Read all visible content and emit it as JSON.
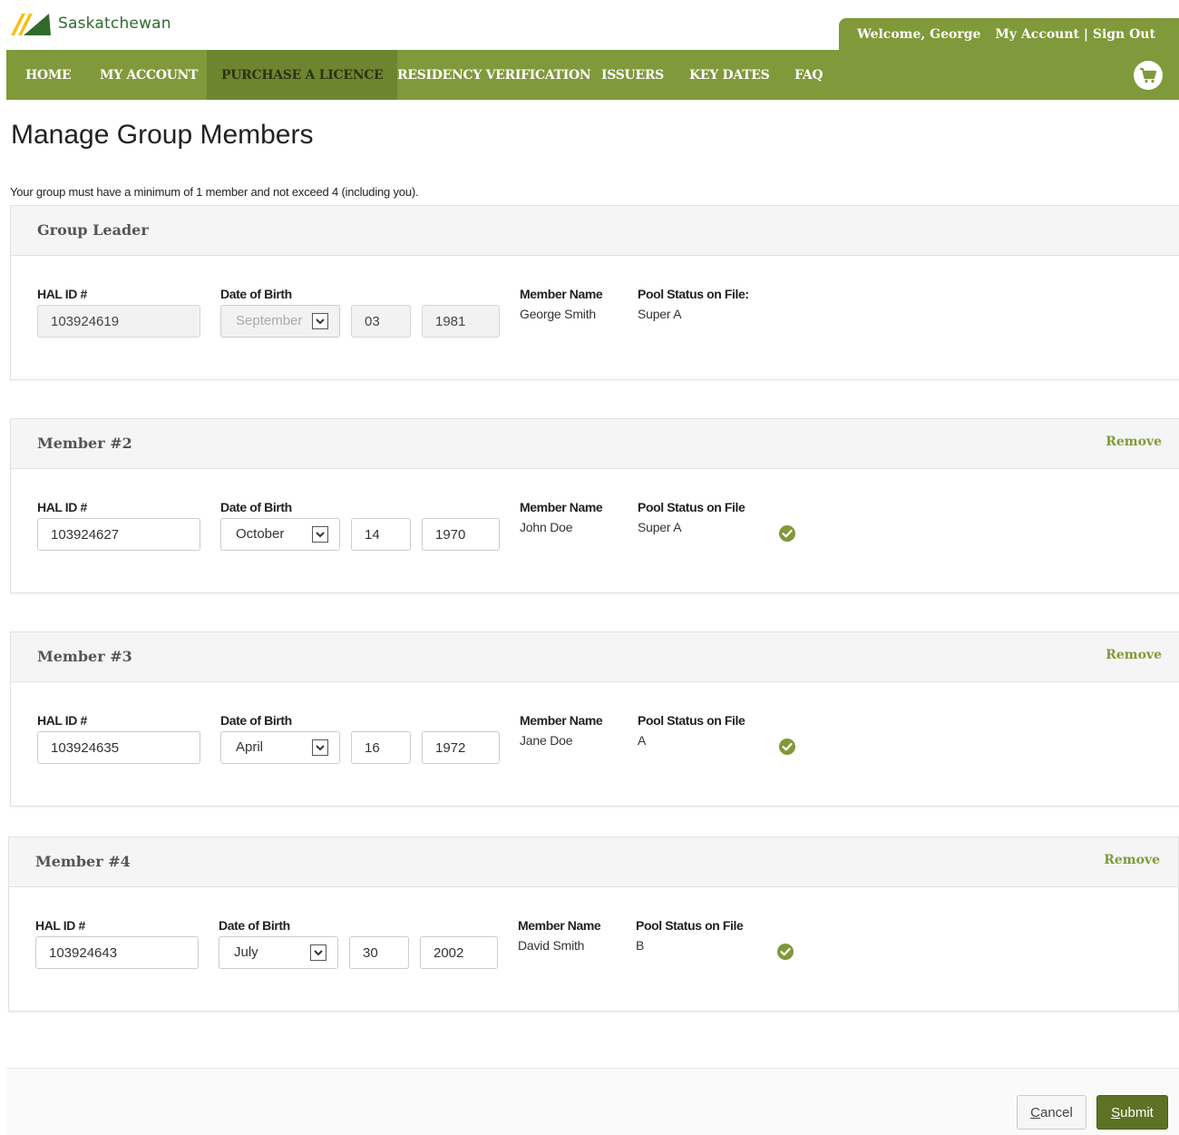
{
  "header": {
    "brand": "Saskatchewan",
    "welcome": "Welcome, George",
    "account_links": "My Account | Sign Out"
  },
  "nav": {
    "items": [
      "HOME",
      "MY ACCOUNT",
      "PURCHASE A LICENCE",
      "RESIDENCY VERIFICATION",
      "ISSUERS",
      "KEY DATES",
      "FAQ"
    ],
    "active": "PURCHASE A LICENCE"
  },
  "page": {
    "title": "Manage Group Members",
    "intro": "Your group must have a minimum of 1 member and not exceed 4 (including you)."
  },
  "labels": {
    "hal_id": "HAL ID #",
    "dob": "Date of Birth",
    "member_name": "Member Name",
    "pool_status_leader": "Pool Status on File:",
    "pool_status": "Pool Status on File",
    "remove": "Remove"
  },
  "members": [
    {
      "title": "Group Leader",
      "hal_id": "103924619",
      "month": "September",
      "day": "03",
      "year": "1981",
      "name": "George Smith",
      "pool": "Super A",
      "removable": false,
      "verified": false
    },
    {
      "title": "Member #2",
      "hal_id": "103924627",
      "month": "October",
      "day": "14",
      "year": "1970",
      "name": "John Doe",
      "pool": "Super A",
      "removable": true,
      "verified": true
    },
    {
      "title": "Member #3",
      "hal_id": "103924635",
      "month": "April",
      "day": "16",
      "year": "1972",
      "name": "Jane Doe",
      "pool": "A",
      "removable": true,
      "verified": true
    },
    {
      "title": "Member #4",
      "hal_id": "103924643",
      "month": "July",
      "day": "30",
      "year": "2002",
      "name": "David Smith",
      "pool": "B",
      "removable": true,
      "verified": true
    }
  ],
  "buttons": {
    "cancel_first": "C",
    "cancel_rest": "ancel",
    "submit_first": "S",
    "submit_rest": "ubmit"
  },
  "colors": {
    "brand_green": "#80993a",
    "active_nav": "#6e8530",
    "submit": "#5d7224"
  },
  "icons": {
    "cart": "cart-icon",
    "check": "check-circle-icon",
    "dropdown": "chevron-down-icon"
  }
}
